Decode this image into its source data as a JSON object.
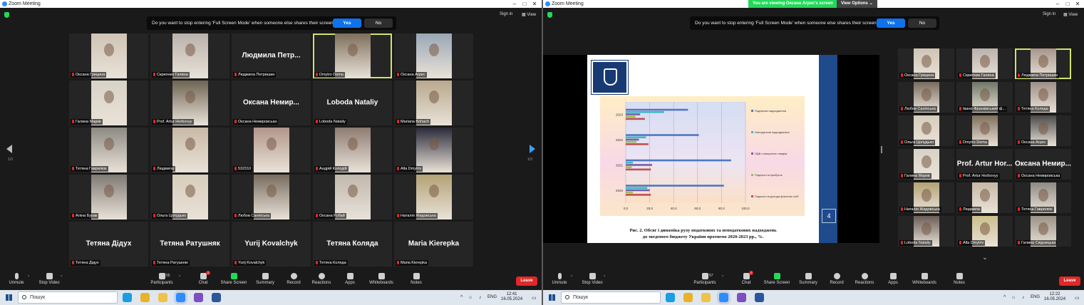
{
  "left": {
    "app_title": "Zoom Meeting",
    "topbar": {
      "sign_in": "Sign in",
      "view": "View"
    },
    "fs_prompt": {
      "text": "Do you want to stop entering 'Full Screen Mode' when someone else shares their screen?",
      "yes": "Yes",
      "no": "No"
    },
    "page_indicator": "1/3",
    "tiles": [
      {
        "name": "Оксана Грицина",
        "video": true,
        "photo_color": "#cfc4b4"
      },
      {
        "name": "Скрипник Галина",
        "video": true,
        "photo_color": "#b9b1ab"
      },
      {
        "name": "Людмила Петришин",
        "video": false,
        "big_name": "Людмила Петр..."
      },
      {
        "name": "Dmytro Dema",
        "video": true,
        "photo_color": "#7e6f5c",
        "active": true
      },
      {
        "name": "Оксана Агрес",
        "video": true,
        "photo_color": "#9aa7b6"
      },
      {
        "name": "Галина Маркв",
        "video": true,
        "photo_color": "#d8d2c6"
      },
      {
        "name": "Prof. Artur Horbovyy",
        "video": true,
        "photo_color": "#6e6453"
      },
      {
        "name": "Оксана Немировська",
        "video": false,
        "big_name": "Оксана Немир..."
      },
      {
        "name": "Loboda Nataliy",
        "video": false,
        "big_name": "Loboda Nataliy"
      },
      {
        "name": "Mariana Bohach",
        "video": true,
        "photo_color": "#b8a88d"
      },
      {
        "name": "Тетяна Гаврилюк",
        "video": true,
        "photo_color": "#8d8a83"
      },
      {
        "name": "Людмила",
        "video": true,
        "photo_color": "#c8b9a5"
      },
      {
        "name": "532310",
        "video": true,
        "photo_color": "#b2968a"
      },
      {
        "name": "Андрій Колодій",
        "video": true,
        "photo_color": "#8e7c72"
      },
      {
        "name": "Alla Dmytriv",
        "video": true,
        "photo_color": "#2a2a3a"
      },
      {
        "name": "Аліна Бурак",
        "video": true,
        "photo_color": "#7e7a74"
      },
      {
        "name": "Ольга Цолудько",
        "video": true,
        "photo_color": "#d7cdbc"
      },
      {
        "name": "Любов Саніяська",
        "video": true,
        "photo_color": "#786c5e"
      },
      {
        "name": "Оксана Рубай",
        "video": true,
        "photo_color": "#c0b7ad"
      },
      {
        "name": "Наталія Жидовська",
        "video": true,
        "photo_color": "#b3a275"
      },
      {
        "name": "Тетяна Дідух",
        "video": false,
        "big_name": "Тетяна Дідух"
      },
      {
        "name": "Тетяна Ратушняк",
        "video": false,
        "big_name": "Тетяна Ратушняк"
      },
      {
        "name": "Yurij Kovalchyk",
        "video": false,
        "big_name": "Yurij Kovalchyk"
      },
      {
        "name": "Тетяна Коляда",
        "video": false,
        "big_name": "Тетяна Коляда"
      },
      {
        "name": "Maria Kierepka",
        "video": false,
        "big_name": "Maria Kierepka"
      }
    ],
    "toolbar": {
      "unmute": "Unmute",
      "stop_video": "Stop Video",
      "participants": "Participants",
      "participants_count": "55",
      "chat": "Chat",
      "chat_badge": "2",
      "share_screen": "Share Screen",
      "summary": "Summary",
      "record": "Record",
      "reactions": "Reactions",
      "apps": "Apps",
      "whiteboards": "Whiteboards",
      "notes": "Notes",
      "leave": "Leave"
    },
    "taskbar": {
      "search": "Пошук",
      "lang": "ENG",
      "time": "12:41",
      "date": "16.05.2024"
    }
  },
  "right": {
    "app_title": "Zoom Meeting",
    "share_banner": "You are viewing Оксана Агрес's screen",
    "view_options": "View Options",
    "topbar": {
      "sign_in": "Sign in",
      "view": "View"
    },
    "fs_prompt": {
      "text": "Do you want to stop entering 'Full Screen Mode' when someone else shares their screen?",
      "yes": "Yes",
      "no": "No"
    },
    "slide": {
      "page": "4",
      "caption_line1": "Рис. 2. Обсяг і динаміка руху податкових та неподаткових надходжень",
      "caption_line2": "до зведеного бюджету України протягом 2020-2023 рр., %."
    },
    "tiles": [
      {
        "name": "Оксана Грицина",
        "video": true,
        "photo_color": "#cfc4b4"
      },
      {
        "name": "Скрипник Галина",
        "video": true,
        "photo_color": "#b9b1ab"
      },
      {
        "name": "Людмила Петришин",
        "video": true,
        "photo_color": "#a8958a",
        "active": true
      },
      {
        "name": "Любов Саніяська",
        "video": true,
        "photo_color": "#786c5e"
      },
      {
        "name": "Івано-Франківський ф...",
        "video": true,
        "photo_color": "#6f7766"
      },
      {
        "name": "Тетяна Коляда",
        "video": true,
        "photo_color": "#9e8f85"
      },
      {
        "name": "Ольга Цолудько",
        "video": true,
        "photo_color": "#d7cdbc"
      },
      {
        "name": "Dmytro Dema",
        "video": true,
        "photo_color": "#7e6f5c"
      },
      {
        "name": "Оксана Агрес",
        "video": true,
        "photo_color": "#4a4a4a"
      },
      {
        "name": "Галина Маркв",
        "video": true,
        "photo_color": "#d8d2c6"
      },
      {
        "name": "Prof. Artur Horbovyy",
        "video": false,
        "big_name": "Prof. Artur Hor..."
      },
      {
        "name": "Оксана Немировська",
        "video": false,
        "big_name": "Оксана Немир..."
      },
      {
        "name": "Наталія Жидовська",
        "video": true,
        "photo_color": "#b3a275"
      },
      {
        "name": "Людмила",
        "video": true,
        "photo_color": "#c8b9a5"
      },
      {
        "name": "Тетяна Гаврилюк",
        "video": true,
        "photo_color": "#8d8a83"
      },
      {
        "name": "Loboda Nataliy",
        "video": true,
        "photo_color": "#6b5d57"
      },
      {
        "name": "Alla Dmytriv",
        "video": true,
        "photo_color": "#cbbf8c"
      },
      {
        "name": "Галина Скідницька",
        "video": true,
        "photo_color": "#9a9285"
      }
    ],
    "toolbar": {
      "unmute": "Unmute",
      "stop_video": "Stop Video",
      "participants": "Participants",
      "participants_count": "57",
      "chat": "Chat",
      "chat_badge": "2",
      "share_screen": "Share Screen",
      "summary": "Summary",
      "record": "Record",
      "reactions": "Reactions",
      "apps": "Apps",
      "whiteboards": "Whiteboards",
      "notes": "Notes",
      "leave": "Leave"
    },
    "taskbar": {
      "search": "Пошук",
      "lang": "ENG",
      "time": "12:22",
      "date": "16.05.2024"
    }
  },
  "chart_data": {
    "type": "bar",
    "orientation": "horizontal",
    "categories": [
      "2020",
      "2021",
      "2022",
      "2023"
    ],
    "series": [
      {
        "name": "Податкові надходження",
        "color": "#4f79bf",
        "values": [
          82,
          88,
          61,
          52
        ]
      },
      {
        "name": "Неподаткові надходження",
        "color": "#40b8c8",
        "values": [
          18,
          6,
          17,
          32
        ]
      },
      {
        "name": "ПДВ з імпортних товарів",
        "color": "#7a5fa8",
        "values": [
          20,
          22,
          11,
          12
        ]
      },
      {
        "name": "Податок на прибуток",
        "color": "#9bbf55",
        "values": [
          6,
          5,
          9,
          8
        ]
      },
      {
        "name": "Податок на доходи фізичних осіб",
        "color": "#c0504d",
        "values": [
          21,
          21,
          19,
          16
        ]
      }
    ],
    "xticks": [
      "0,0",
      "20,0",
      "40,0",
      "60,0",
      "80,0",
      "100,0"
    ],
    "xlim": [
      0,
      100
    ],
    "grid": true,
    "legend": "right"
  }
}
